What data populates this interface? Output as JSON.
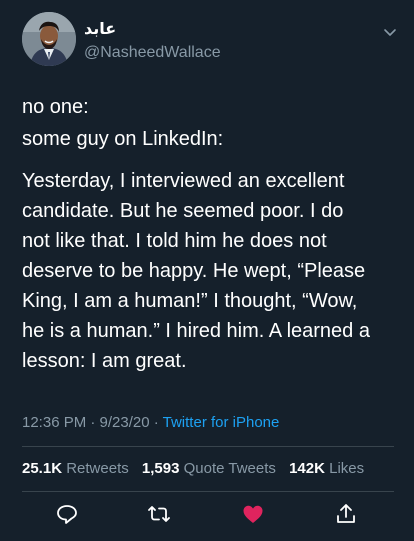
{
  "user": {
    "display_name": "عابد",
    "handle": "@NasheedWallace"
  },
  "tweet": {
    "line1": "no one:",
    "line2": "some guy on LinkedIn:",
    "text": "Yesterday, I interviewed an excellent\ncandidate. But he seemed poor. I do\nnot like that. I told him he does not\ndeserve to be happy. He wept, “Please\nKing, I am a human!” I thought, “Wow,\nhe is a human.” I hired him. A learned a\nlesson: I am great.",
    "time": "12:36 PM · 9/23/20 · ",
    "source": "Twitter for iPhone"
  },
  "stats": {
    "retweets_count": "25.1K",
    "retweets_label": "Retweets",
    "quotes_count": "1,593",
    "quotes_label": "Quote Tweets",
    "likes_count": "142K",
    "likes_label": "Likes"
  },
  "icons": {
    "reply": "reply-icon",
    "retweet": "retweet-icon",
    "like": "heart-icon",
    "share": "share-icon",
    "caret": "chevron-down-icon"
  },
  "colors": {
    "background": "#15202b",
    "secondary_text": "#8899a6",
    "link": "#1da1f2",
    "like": "#e0245e"
  }
}
